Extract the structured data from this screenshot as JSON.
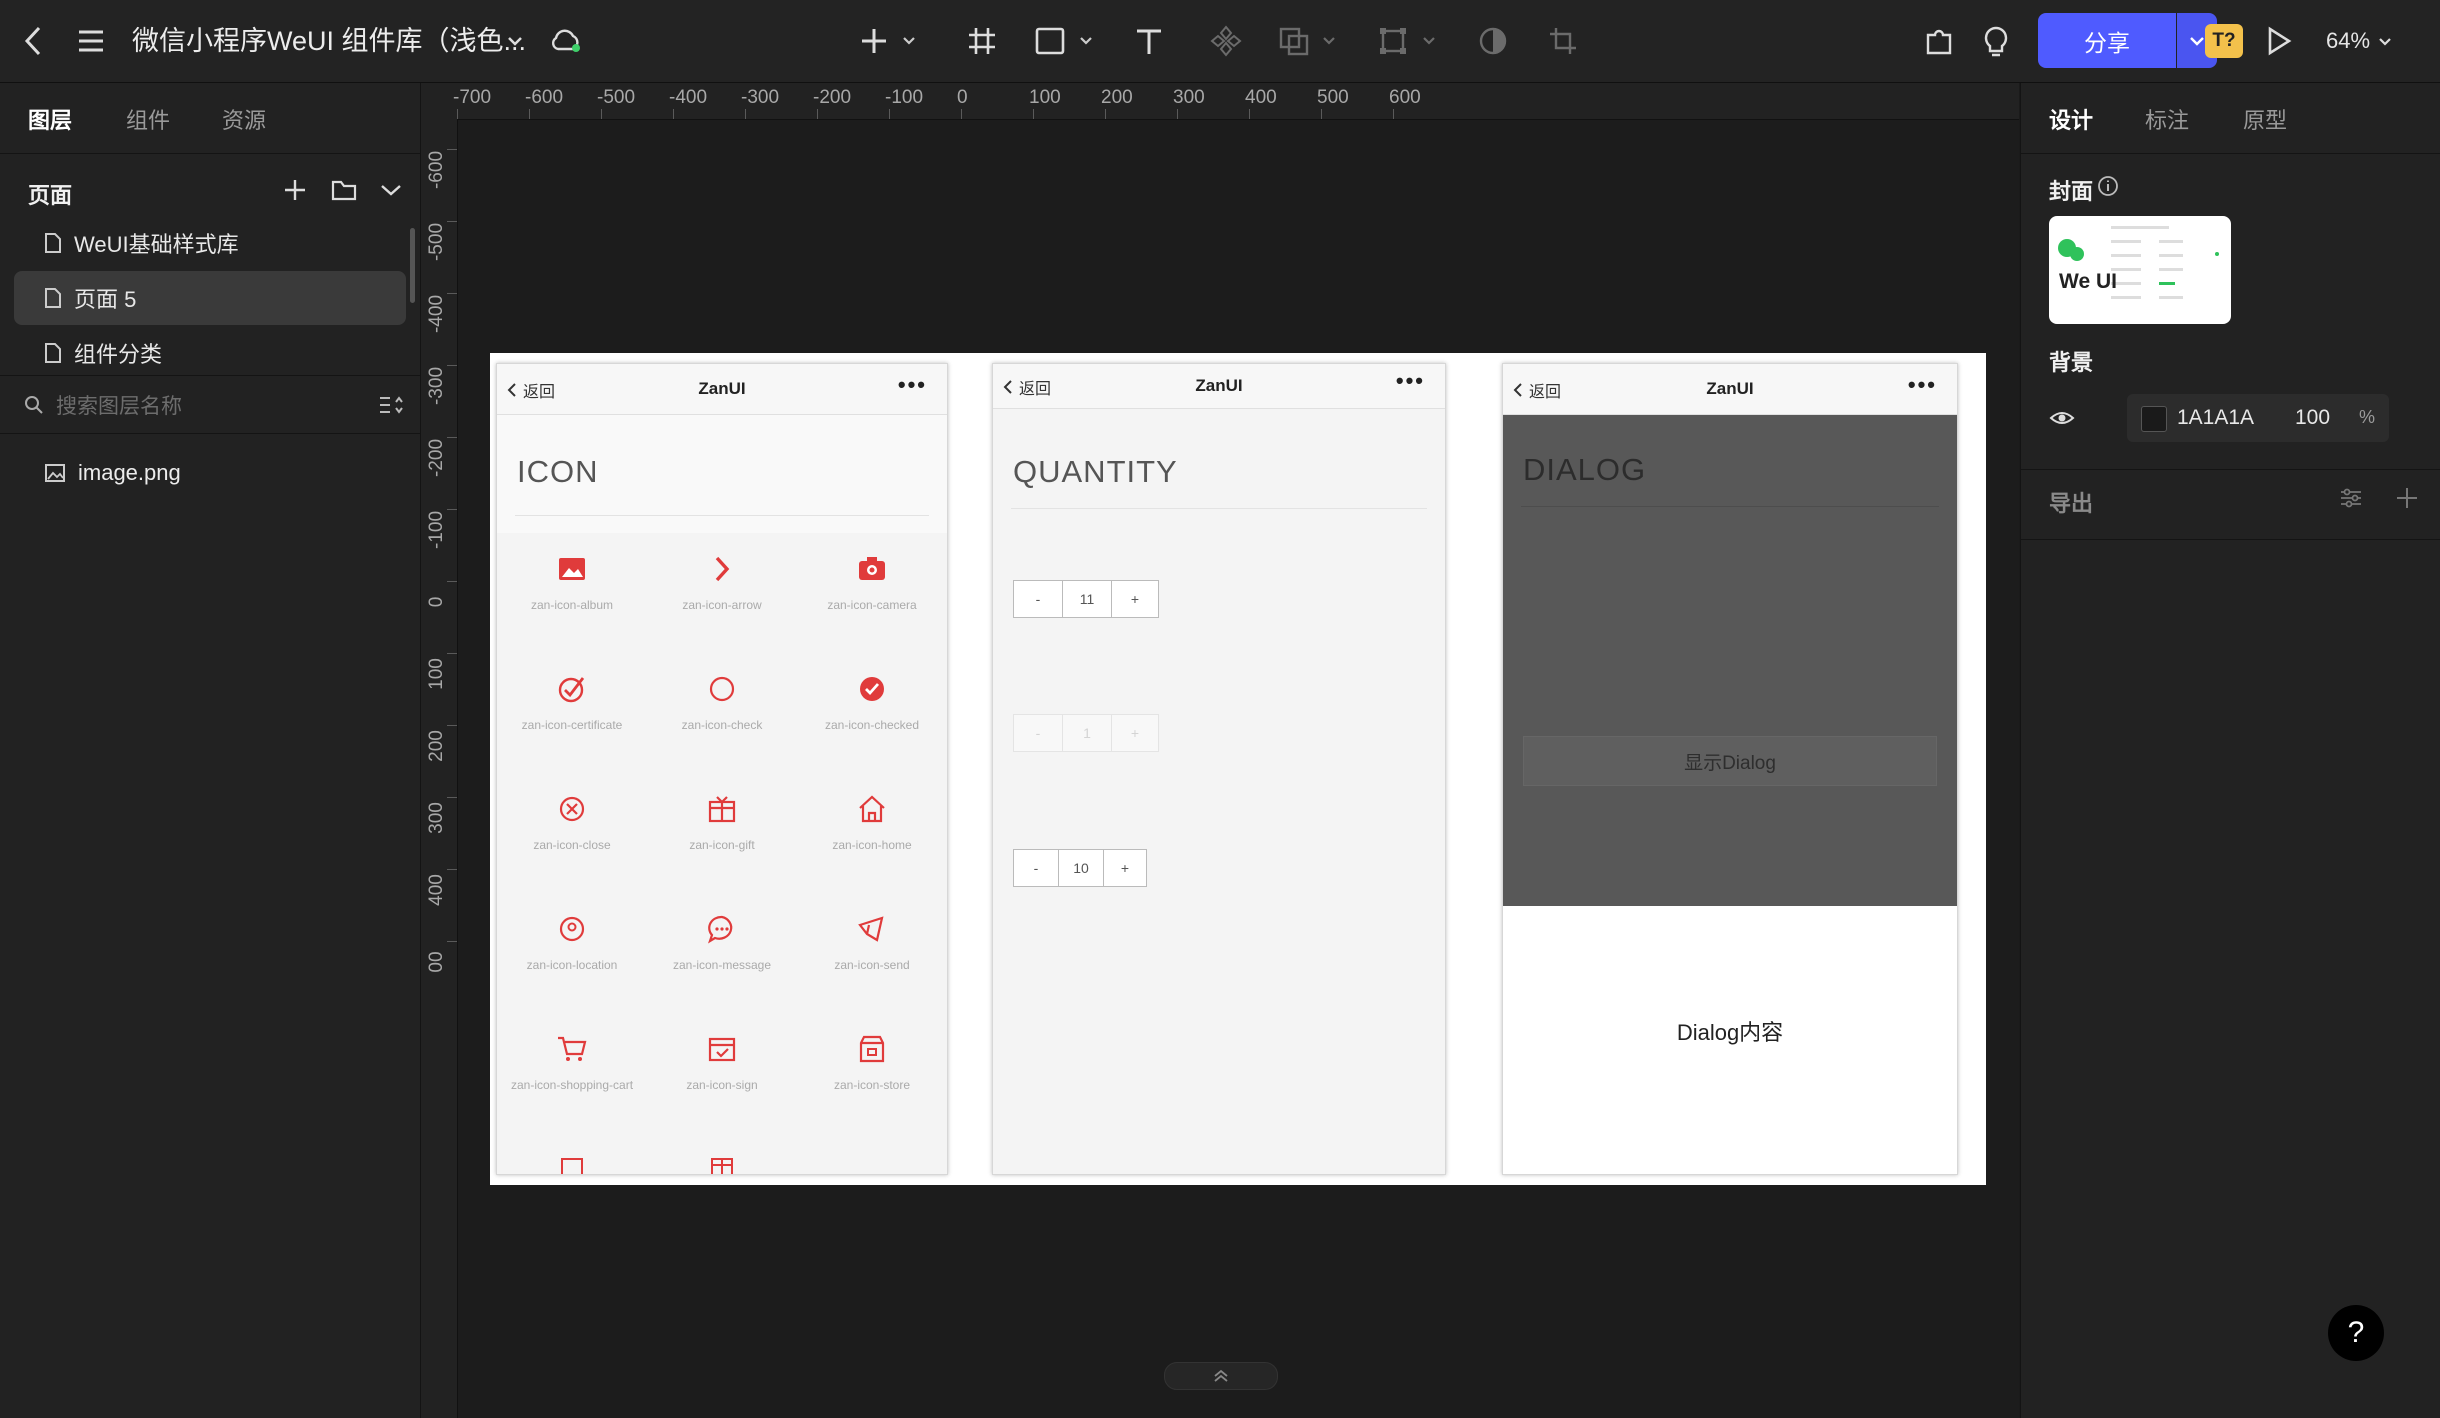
{
  "topbar": {
    "title": "微信小程序WeUI 组件库（浅色...",
    "share_label": "分享",
    "zoom": "64%",
    "ai_badge": "T?"
  },
  "left_panel": {
    "tabs": [
      "图层",
      "组件",
      "资源"
    ],
    "pages_header": "页面",
    "pages": [
      "WeUI基础样式库",
      "页面 5",
      "组件分类"
    ],
    "search_placeholder": "搜索图层名称",
    "layers": [
      "image.png"
    ]
  },
  "rulers": {
    "h_ticks": [
      "-700",
      "-600",
      "-500",
      "-400",
      "-300",
      "-200",
      "-100",
      "0",
      "100",
      "200",
      "300",
      "400",
      "500",
      "600"
    ],
    "v_ticks": [
      "-600",
      "-500",
      "-400",
      "-300",
      "-200",
      "-100",
      "0",
      "100",
      "200",
      "300",
      "400",
      "00"
    ]
  },
  "artboard": {
    "phones": [
      {
        "back": "返回",
        "title": "ZanUI",
        "dots": "•••",
        "heading": "ICON"
      },
      {
        "back": "返回",
        "title": "ZanUI",
        "dots": "•••",
        "heading": "QUANTITY"
      },
      {
        "back": "返回",
        "title": "ZanUI",
        "dots": "•••",
        "heading": "DIALOG"
      }
    ],
    "icon_labels": [
      "zan-icon-album",
      "zan-icon-arrow",
      "zan-icon-camera",
      "zan-icon-certificate",
      "zan-icon-check",
      "zan-icon-checked",
      "zan-icon-close",
      "zan-icon-gift",
      "zan-icon-home",
      "zan-icon-location",
      "zan-icon-message",
      "zan-icon-send",
      "zan-icon-shopping-cart",
      "zan-icon-sign",
      "zan-icon-store"
    ],
    "steppers": [
      {
        "minus": "-",
        "value": "11",
        "plus": "+"
      },
      {
        "minus": "-",
        "value": "1",
        "plus": "+"
      },
      {
        "minus": "-",
        "value": "10",
        "plus": "+"
      }
    ],
    "dialog_button": "显示Dialog",
    "dialog_content": "Dialog内容"
  },
  "right_panel": {
    "tabs": [
      "设计",
      "标注",
      "原型"
    ],
    "cover_label": "封面",
    "cover_thumb_text": "We UI",
    "background_label": "背景",
    "background_hex": "1A1A1A",
    "background_opacity": "100",
    "background_pct": "%",
    "export_label": "导出"
  },
  "help": "?",
  "colors": {
    "accent": "#4f5bff",
    "icon_red": "#e03b3b",
    "canvas_bg": "#1A1A1A"
  }
}
